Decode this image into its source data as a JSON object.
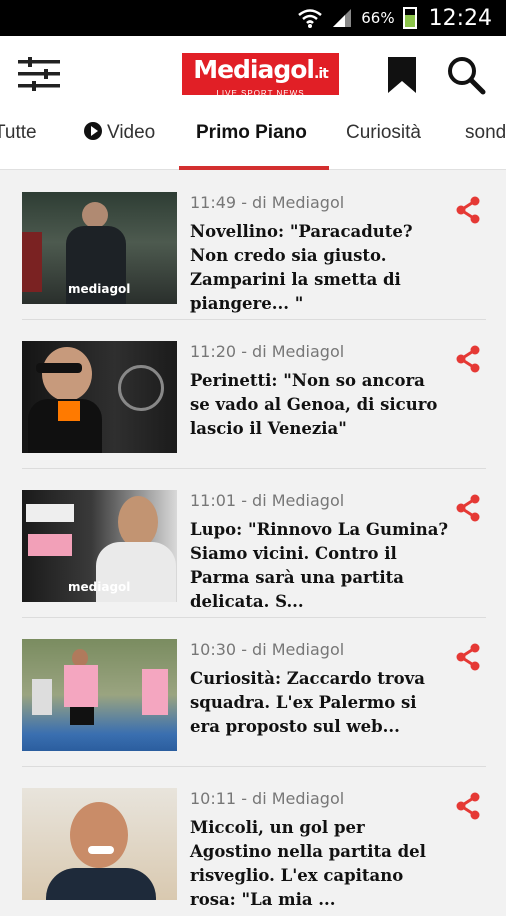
{
  "status_bar": {
    "battery": "66%",
    "time": "12:24"
  },
  "header": {
    "logo_text": "Mediagol",
    "logo_suffix": ".it",
    "logo_tagline": "LIVE SPORT NEWS"
  },
  "tabs": [
    {
      "label": "Tutte"
    },
    {
      "label": "Video"
    },
    {
      "label": "Primo Piano"
    },
    {
      "label": "Curiosità"
    },
    {
      "label": "sond"
    }
  ],
  "articles": [
    {
      "meta": "11:49 - di Mediagol",
      "headline": "Novellino: \"Paracadute? Non credo sia giusto. Zamparini la smetta di piangere... \"",
      "thumb_watermark": "mediagol"
    },
    {
      "meta": "11:20 - di Mediagol",
      "headline": "Perinetti: \"Non so ancora se vado al Genoa, di sicuro lascio il Venezia\"",
      "thumb_watermark": ""
    },
    {
      "meta": "11:01 - di Mediagol",
      "headline": "Lupo: \"Rinnovo La Gumina? Siamo vicini. Contro il Parma sarà una partita delicata. S...",
      "thumb_watermark": "mediagol"
    },
    {
      "meta": "10:30 - di Mediagol",
      "headline": "Curiosità: Zaccardo trova squadra. L'ex Palermo si era proposto sul web...",
      "thumb_watermark": ""
    },
    {
      "meta": "10:11 - di Mediagol",
      "headline": "Miccoli, un gol per Agostino nella partita del risveglio. L'ex capitano rosa: \"La mia ...",
      "thumb_watermark": ""
    }
  ],
  "colors": {
    "accent": "#d32f2f",
    "logo_bg": "#e11f26"
  }
}
